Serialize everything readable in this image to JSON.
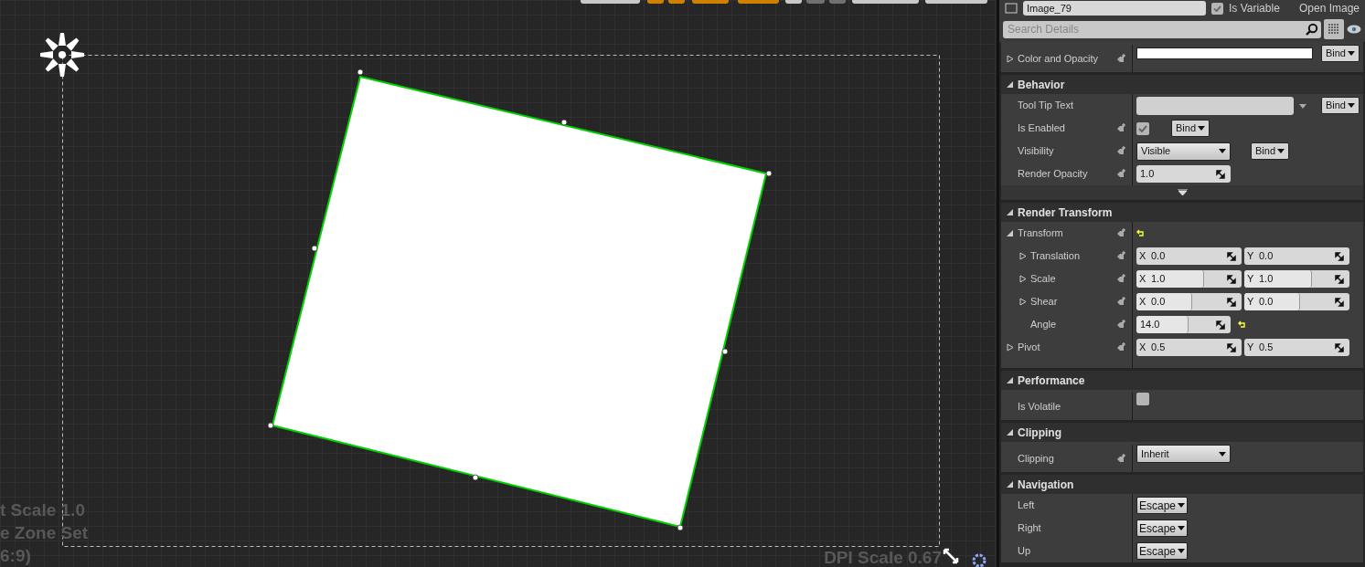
{
  "canvas": {
    "overlay_lines": [
      "t Scale 1.0",
      "e Zone Set",
      "6:9)"
    ],
    "dpi_scale": "DPI Scale 0.67"
  },
  "details": {
    "name_field": "Image_79",
    "is_variable": {
      "label": "Is Variable",
      "checked": true
    },
    "open_link": "Open Image",
    "search": {
      "placeholder": "Search Details"
    },
    "sections": [
      {
        "rows": [
          {
            "label": "Color and Opacity",
            "kind": "color",
            "expandable": true,
            "expanded": false,
            "property_icon": true,
            "color": "#ffffff",
            "bind": "Bind"
          }
        ]
      },
      {
        "title": "Behavior",
        "expanded": true,
        "advanced": true,
        "rows": [
          {
            "label": "Tool Tip Text",
            "kind": "text",
            "property_icon": false,
            "value": "",
            "bind": "Bind"
          },
          {
            "label": "Is Enabled",
            "kind": "checkbox",
            "property_icon": true,
            "checked": true,
            "bind": "Bind"
          },
          {
            "label": "Visibility",
            "kind": "combo",
            "property_icon": true,
            "value": "Visible",
            "bind": "Bind"
          },
          {
            "label": "Render Opacity",
            "kind": "number",
            "property_icon": true,
            "value": "1.0"
          }
        ]
      },
      {
        "title": "Render Transform",
        "expanded": true,
        "rows": [
          {
            "label": "Transform",
            "kind": "group",
            "expandable": true,
            "expanded": true,
            "property_icon": true,
            "modified": true,
            "children": [
              {
                "label": "Translation",
                "kind": "vector",
                "expandable": true,
                "expanded": false,
                "property_icon": true,
                "x": {
                  "axis": "X",
                  "value": "0.0"
                },
                "y": {
                  "axis": "Y",
                  "value": "0.0"
                }
              },
              {
                "label": "Scale",
                "kind": "vector",
                "expandable": true,
                "expanded": false,
                "property_icon": true,
                "x": {
                  "axis": "X",
                  "value": "1.0",
                  "level": 0.64
                },
                "y": {
                  "axis": "Y",
                  "value": "1.0",
                  "level": 0.64
                }
              },
              {
                "label": "Shear",
                "kind": "vector",
                "expandable": true,
                "expanded": false,
                "property_icon": true,
                "x": {
                  "axis": "X",
                  "value": "0.0",
                  "level": 0.53
                },
                "y": {
                  "axis": "Y",
                  "value": "0.0",
                  "level": 0.53
                }
              },
              {
                "label": "Angle",
                "kind": "slider",
                "property_icon": true,
                "value": "14.0",
                "level": 0.55,
                "modified": true
              }
            ]
          },
          {
            "label": "Pivot",
            "kind": "vector",
            "expandable": true,
            "expanded": false,
            "property_icon": true,
            "x": {
              "axis": "X",
              "value": "0.5"
            },
            "y": {
              "axis": "Y",
              "value": "0.5"
            }
          }
        ]
      },
      {
        "title": "Performance",
        "expanded": true,
        "rows": [
          {
            "label": "Is Volatile",
            "kind": "checkbox",
            "property_icon": false,
            "checked": false
          }
        ]
      },
      {
        "title": "Clipping",
        "expanded": true,
        "rows": [
          {
            "label": "Clipping",
            "kind": "combo",
            "property_icon": true,
            "value": "Inherit"
          }
        ]
      },
      {
        "title": "Navigation",
        "expanded": true,
        "rows": [
          {
            "label": "Left",
            "kind": "menu",
            "property_icon": false,
            "value": "Escape"
          },
          {
            "label": "Right",
            "kind": "menu",
            "property_icon": false,
            "value": "Escape"
          },
          {
            "label": "Up",
            "kind": "menu",
            "property_icon": false,
            "value": "Escape"
          }
        ]
      }
    ]
  }
}
